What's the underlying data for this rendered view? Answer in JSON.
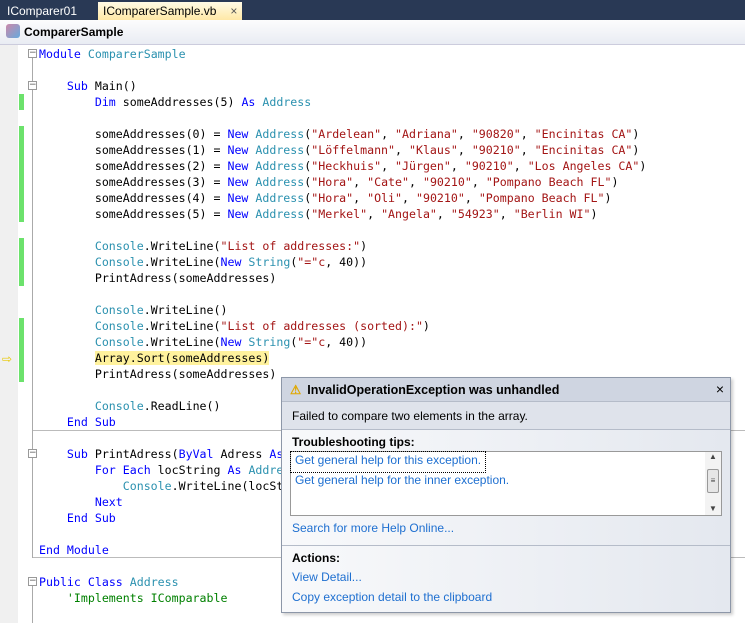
{
  "tabs": [
    {
      "label": "IComparer01"
    },
    {
      "label": "IComparerSample.vb",
      "close": "×"
    }
  ],
  "navbar": {
    "class_name": "ComparerSample"
  },
  "code_lines": [
    [
      [
        "Module ",
        "kw"
      ],
      [
        "ComparerSample",
        "ty"
      ]
    ],
    [],
    [
      [
        "    Sub ",
        "kw"
      ],
      [
        "Main()",
        ""
      ]
    ],
    [
      [
        "        Dim ",
        "kw"
      ],
      [
        "someAddresses(5) ",
        ""
      ],
      [
        "As ",
        "kw"
      ],
      [
        "Address",
        "ty"
      ]
    ],
    [],
    [
      [
        "        someAddresses(0) = ",
        ""
      ],
      [
        "New ",
        "kw"
      ],
      [
        "Address",
        "ty"
      ],
      [
        "(",
        ""
      ],
      [
        "\"Ardelean\"",
        "st"
      ],
      [
        ", ",
        ""
      ],
      [
        "\"Adriana\"",
        "st"
      ],
      [
        ", ",
        ""
      ],
      [
        "\"90820\"",
        "st"
      ],
      [
        ", ",
        ""
      ],
      [
        "\"Encinitas CA\"",
        "st"
      ],
      [
        ")",
        ""
      ]
    ],
    [
      [
        "        someAddresses(1) = ",
        ""
      ],
      [
        "New ",
        "kw"
      ],
      [
        "Address",
        "ty"
      ],
      [
        "(",
        ""
      ],
      [
        "\"Löffelmann\"",
        "st"
      ],
      [
        ", ",
        ""
      ],
      [
        "\"Klaus\"",
        "st"
      ],
      [
        ", ",
        ""
      ],
      [
        "\"90210\"",
        "st"
      ],
      [
        ", ",
        ""
      ],
      [
        "\"Encinitas CA\"",
        "st"
      ],
      [
        ")",
        ""
      ]
    ],
    [
      [
        "        someAddresses(2) = ",
        ""
      ],
      [
        "New ",
        "kw"
      ],
      [
        "Address",
        "ty"
      ],
      [
        "(",
        ""
      ],
      [
        "\"Heckhuis\"",
        "st"
      ],
      [
        ", ",
        ""
      ],
      [
        "\"Jürgen\"",
        "st"
      ],
      [
        ", ",
        ""
      ],
      [
        "\"90210\"",
        "st"
      ],
      [
        ", ",
        ""
      ],
      [
        "\"Los Angeles CA\"",
        "st"
      ],
      [
        ")",
        ""
      ]
    ],
    [
      [
        "        someAddresses(3) = ",
        ""
      ],
      [
        "New ",
        "kw"
      ],
      [
        "Address",
        "ty"
      ],
      [
        "(",
        ""
      ],
      [
        "\"Hora\"",
        "st"
      ],
      [
        ", ",
        ""
      ],
      [
        "\"Cate\"",
        "st"
      ],
      [
        ", ",
        ""
      ],
      [
        "\"90210\"",
        "st"
      ],
      [
        ", ",
        ""
      ],
      [
        "\"Pompano Beach FL\"",
        "st"
      ],
      [
        ")",
        ""
      ]
    ],
    [
      [
        "        someAddresses(4) = ",
        ""
      ],
      [
        "New ",
        "kw"
      ],
      [
        "Address",
        "ty"
      ],
      [
        "(",
        ""
      ],
      [
        "\"Hora\"",
        "st"
      ],
      [
        ", ",
        ""
      ],
      [
        "\"Oli\"",
        "st"
      ],
      [
        ", ",
        ""
      ],
      [
        "\"90210\"",
        "st"
      ],
      [
        ", ",
        ""
      ],
      [
        "\"Pompano Beach FL\"",
        "st"
      ],
      [
        ")",
        ""
      ]
    ],
    [
      [
        "        someAddresses(5) = ",
        ""
      ],
      [
        "New ",
        "kw"
      ],
      [
        "Address",
        "ty"
      ],
      [
        "(",
        ""
      ],
      [
        "\"Merkel\"",
        "st"
      ],
      [
        ", ",
        ""
      ],
      [
        "\"Angela\"",
        "st"
      ],
      [
        ", ",
        ""
      ],
      [
        "\"54923\"",
        "st"
      ],
      [
        ", ",
        ""
      ],
      [
        "\"Berlin WI\"",
        "st"
      ],
      [
        ")",
        ""
      ]
    ],
    [],
    [
      [
        "        ",
        ""
      ],
      [
        "Console",
        "ty"
      ],
      [
        ".WriteLine(",
        ""
      ],
      [
        "\"List of addresses:\"",
        "st"
      ],
      [
        ")",
        ""
      ]
    ],
    [
      [
        "        ",
        ""
      ],
      [
        "Console",
        "ty"
      ],
      [
        ".WriteLine(",
        ""
      ],
      [
        "New ",
        "kw"
      ],
      [
        "String",
        "ty"
      ],
      [
        "(",
        ""
      ],
      [
        "\"=\"c",
        "st"
      ],
      [
        ", 40))",
        ""
      ]
    ],
    [
      [
        "        PrintAdress(someAddresses)",
        ""
      ]
    ],
    [],
    [
      [
        "        ",
        ""
      ],
      [
        "Console",
        "ty"
      ],
      [
        ".WriteLine()",
        ""
      ]
    ],
    [
      [
        "        ",
        ""
      ],
      [
        "Console",
        "ty"
      ],
      [
        ".WriteLine(",
        ""
      ],
      [
        "\"List of addresses (sorted):\"",
        "st"
      ],
      [
        ")",
        ""
      ]
    ],
    [
      [
        "        ",
        ""
      ],
      [
        "Console",
        "ty"
      ],
      [
        ".WriteLine(",
        ""
      ],
      [
        "New ",
        "kw"
      ],
      [
        "String",
        "ty"
      ],
      [
        "(",
        ""
      ],
      [
        "\"=\"c",
        "st"
      ],
      [
        ", 40))",
        ""
      ]
    ],
    [
      [
        "        ",
        ""
      ],
      [
        "Array.Sort(someAddresses)",
        "hl"
      ]
    ],
    [
      [
        "        PrintAdress(someAddresses)",
        ""
      ]
    ],
    [],
    [
      [
        "        ",
        ""
      ],
      [
        "Console",
        "ty"
      ],
      [
        ".ReadLine()",
        ""
      ]
    ],
    [
      [
        "    End Sub",
        "kw"
      ]
    ],
    [],
    [
      [
        "    Sub ",
        "kw"
      ],
      [
        "PrintAdress(",
        ""
      ],
      [
        "ByVal ",
        "kw"
      ],
      [
        "Adress ",
        ""
      ],
      [
        "As",
        "kw"
      ]
    ],
    [
      [
        "        For Each ",
        "kw"
      ],
      [
        "locString ",
        ""
      ],
      [
        "As ",
        "kw"
      ],
      [
        "Addre",
        "ty"
      ]
    ],
    [
      [
        "            ",
        ""
      ],
      [
        "Console",
        "ty"
      ],
      [
        ".WriteLine(locSt",
        ""
      ]
    ],
    [
      [
        "        Next",
        "kw"
      ]
    ],
    [
      [
        "    End Sub",
        "kw"
      ]
    ],
    [],
    [
      [
        "End ",
        "kw"
      ],
      [
        "Module",
        "kw"
      ]
    ],
    [],
    [
      [
        "Public ",
        "kw"
      ],
      [
        "Class ",
        "kw"
      ],
      [
        "Address",
        "ty"
      ]
    ],
    [
      [
        "    'Implements IComparable",
        "cm"
      ]
    ]
  ],
  "exception": {
    "icon": "warning-icon",
    "title": "InvalidOperationException was unhandled",
    "close": "×",
    "message": "Failed to compare two elements in the array.",
    "tips_heading": "Troubleshooting tips:",
    "tips": [
      "Get general help for this exception.",
      "Get general help for the inner exception."
    ],
    "search_link": "Search for more Help Online...",
    "actions_heading": "Actions:",
    "actions": [
      "View Detail...",
      "Copy exception detail to the clipboard"
    ]
  },
  "colors": {
    "keyword": "#0000ff",
    "type": "#2b91af",
    "string": "#a31515",
    "comment": "#008000",
    "tabbar": "#293955",
    "change_bar": "#6ce26c"
  }
}
